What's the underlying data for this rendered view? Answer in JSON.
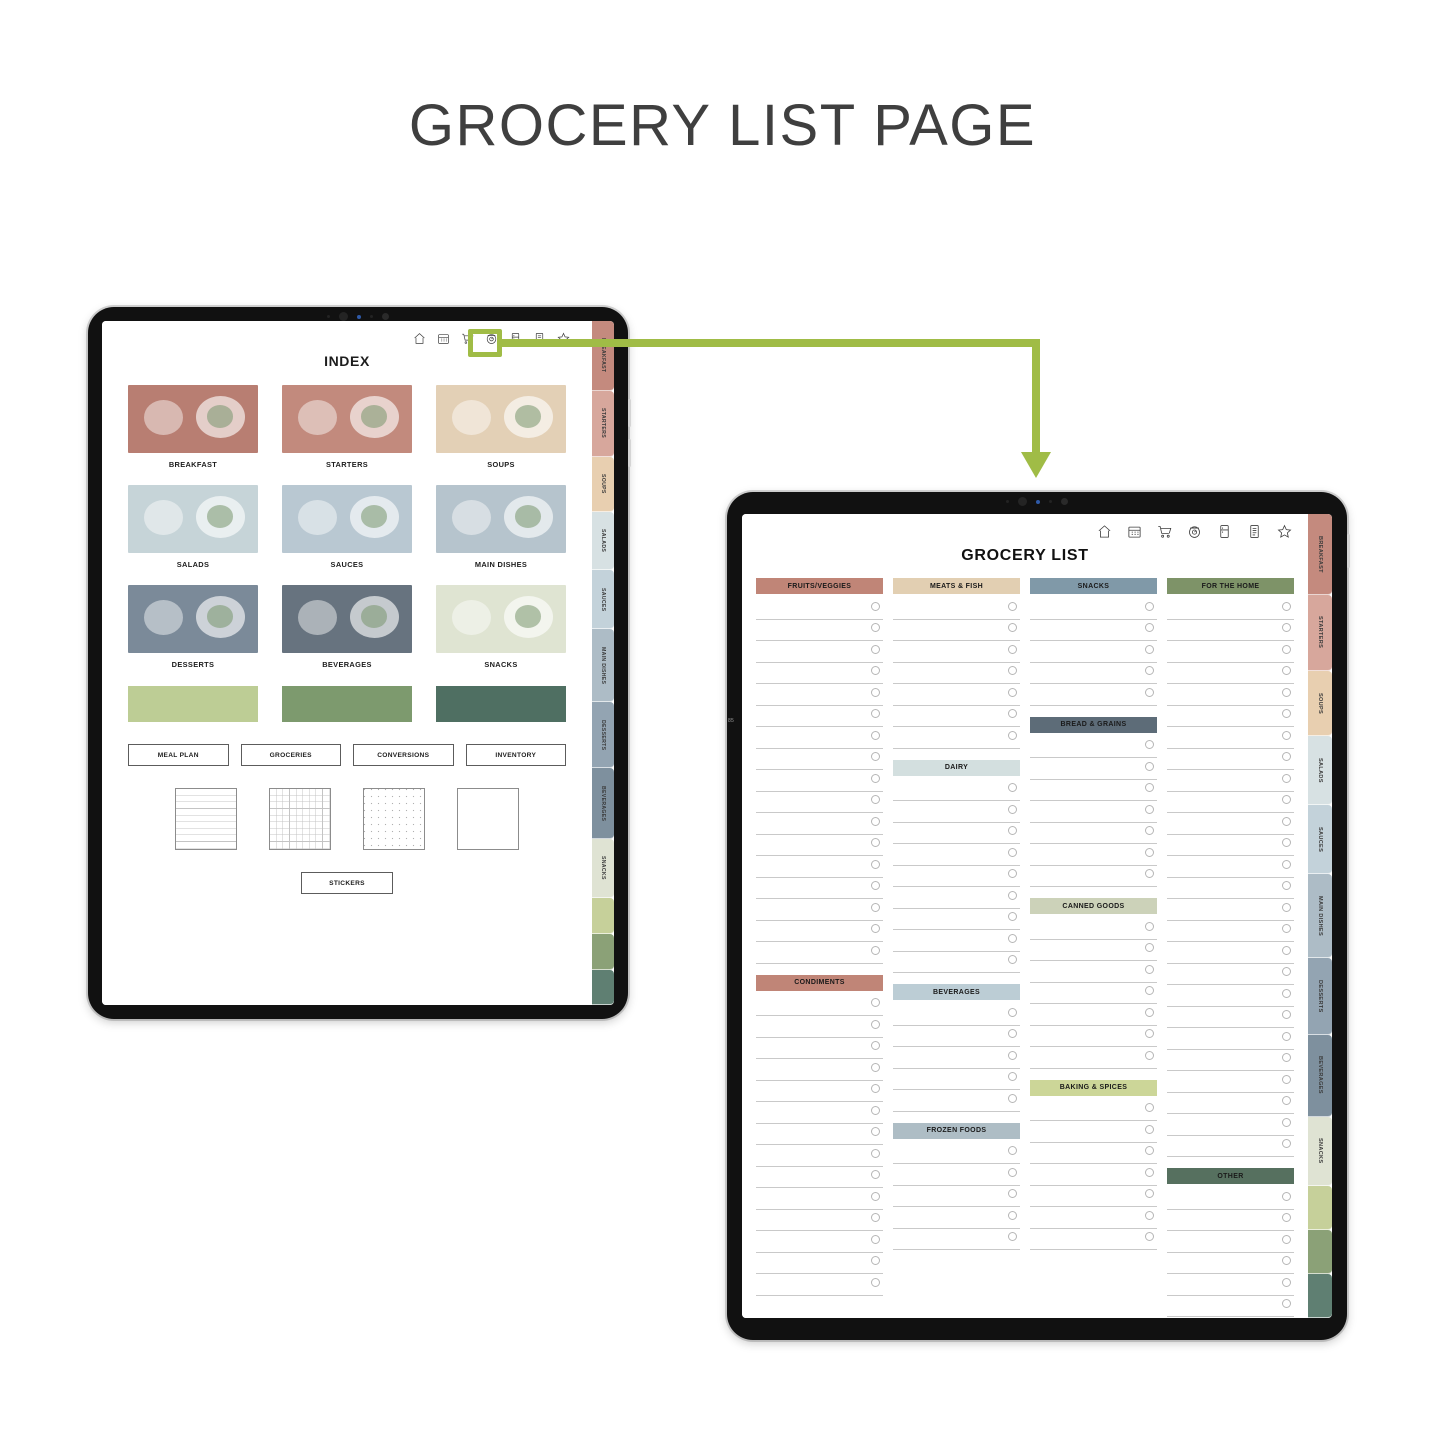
{
  "page": {
    "title": "GROCERY LIST PAGE",
    "edge_mark": "85"
  },
  "colors": {
    "annotation_green": "#a0bc46",
    "frame_black": "#111111"
  },
  "toolbar_icons": [
    {
      "name": "home-icon",
      "label": "Home"
    },
    {
      "name": "calendar-icon",
      "label": "Calendar"
    },
    {
      "name": "cart-icon",
      "label": "Groceries"
    },
    {
      "name": "scale-icon",
      "label": "Conversions"
    },
    {
      "name": "fridge-icon",
      "label": "Inventory"
    },
    {
      "name": "notes-icon",
      "label": "Notes"
    },
    {
      "name": "star-icon",
      "label": "Favorites"
    }
  ],
  "index_tabs": [
    {
      "label": "BREAKFAST",
      "color": "#c48a7e"
    },
    {
      "label": "STARTERS",
      "color": "#d7a79c"
    },
    {
      "label": "SOUPS",
      "color": "#e8cfb0"
    },
    {
      "label": "SALADS",
      "color": "#d7e1e3"
    },
    {
      "label": "SAUCES",
      "color": "#c3d2da"
    },
    {
      "label": "MAIN DISHES",
      "color": "#adbcc6"
    },
    {
      "label": "DESSERTS",
      "color": "#93a4b2"
    },
    {
      "label": "BEVERAGES",
      "color": "#7e909e"
    },
    {
      "label": "SNACKS",
      "color": "#dfe3d3"
    },
    {
      "label": "",
      "color": "#c6d09a"
    },
    {
      "label": "",
      "color": "#8ba177"
    },
    {
      "label": "",
      "color": "#5f7f72"
    }
  ],
  "left_tablet": {
    "page_title": "INDEX",
    "categories": [
      {
        "label": "BREAKFAST",
        "bg": "#b87e72"
      },
      {
        "label": "STARTERS",
        "bg": "#c28a7d"
      },
      {
        "label": "SOUPS",
        "bg": "#e3d0b6"
      },
      {
        "label": "SALADS",
        "bg": "#c6d4d8"
      },
      {
        "label": "SAUCES",
        "bg": "#b9c8d2"
      },
      {
        "label": "MAIN DISHES",
        "bg": "#b6c4cd"
      },
      {
        "label": "DESSERTS",
        "bg": "#7b8a99"
      },
      {
        "label": "BEVERAGES",
        "bg": "#67737f"
      },
      {
        "label": "SNACKS",
        "bg": "#dfe4d2"
      }
    ],
    "swatches": [
      {
        "name": "swatch-light-green",
        "color": "#bdcd95"
      },
      {
        "name": "swatch-mid-green",
        "color": "#7d9a6e"
      },
      {
        "name": "swatch-dark-green",
        "color": "#4f6f62"
      }
    ],
    "buttons": [
      "MEAL PLAN",
      "GROCERIES",
      "CONVERSIONS",
      "INVENTORY"
    ],
    "papers": [
      "lined",
      "grid",
      "dotted",
      "blank"
    ],
    "sticker_button": "STICKERS"
  },
  "right_tablet": {
    "page_title": "GROCERY LIST",
    "columns": [
      {
        "name": "column-1",
        "sections": [
          {
            "title": "FRUITS/VEGGIES",
            "color": "#c08577",
            "rows": 17
          },
          {
            "title": "CONDIMENTS",
            "color": "#c08577",
            "rows": 14
          }
        ]
      },
      {
        "name": "column-2",
        "sections": [
          {
            "title": "MEATS & FISH",
            "color": "#e2cfb2",
            "rows": 7
          },
          {
            "title": "DAIRY",
            "color": "#d3dfdf",
            "rows": 9
          },
          {
            "title": "BEVERAGES",
            "color": "#bccdd5",
            "rows": 5
          },
          {
            "title": "FROZEN FOODS",
            "color": "#aebdc5",
            "rows": 5
          }
        ]
      },
      {
        "name": "column-3",
        "sections": [
          {
            "title": "SNACKS",
            "color": "#8099a8",
            "rows": 5
          },
          {
            "title": "BREAD & GRAINS",
            "color": "#5d6c78",
            "rows": 7
          },
          {
            "title": "CANNED GOODS",
            "color": "#ccd2b9",
            "rows": 7
          },
          {
            "title": "BAKING & SPICES",
            "color": "#ccd698",
            "rows": 7
          }
        ]
      },
      {
        "name": "column-4",
        "sections": [
          {
            "title": "FOR THE HOME",
            "color": "#7e9368",
            "rows": 26
          },
          {
            "title": "OTHER",
            "color": "#56705f",
            "rows": 7
          }
        ]
      }
    ]
  },
  "annotation": {
    "highlight_target": "cart-icon",
    "arrow_direction": "right-then-down"
  }
}
